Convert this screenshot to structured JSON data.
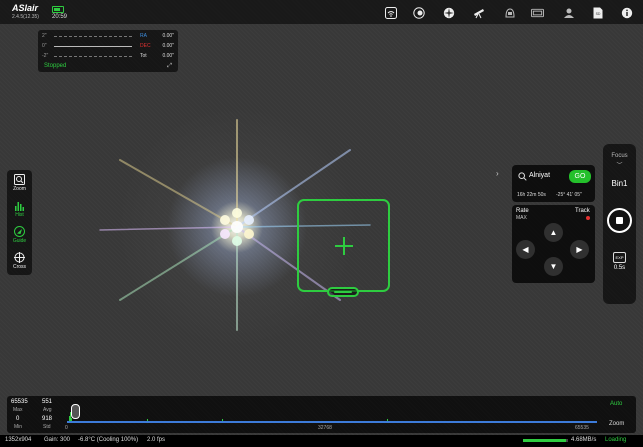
{
  "app": {
    "logo": "ASIair",
    "version": "2.4.5(12.35)",
    "clock": "20:59"
  },
  "topbar_icons": [
    "wifi-icon",
    "camera-icon",
    "guide-scope-icon",
    "telescope-icon",
    "mount-icon",
    "filter-wheel-icon",
    "focuser-icon",
    "storage-icon",
    "info-icon"
  ],
  "guide_graph": {
    "scales": [
      "2\"",
      "0\"",
      "-2\""
    ],
    "ra_label": "RA",
    "ra_value": "0.00\"",
    "dec_label": "DEC",
    "dec_value": "0.00\"",
    "tot_label": "Tot",
    "tot_value": "0.00\"",
    "status": "Stopped",
    "colors": {
      "ra": "#3d8ee0",
      "dec": "#e23131"
    }
  },
  "left_toolbar": [
    {
      "label": "Zoom",
      "icon": "zoom-icon"
    },
    {
      "label": "Hist",
      "icon": "histogram-icon"
    },
    {
      "label": "Guide",
      "icon": "guide-icon"
    },
    {
      "label": "Cross",
      "icon": "crosshair-icon"
    }
  ],
  "target": {
    "name": "Alniyat",
    "go_label": "GO",
    "ra": "16h 22m 50s",
    "dec": "-25° 41' 05\""
  },
  "mount": {
    "rate_label": "Rate",
    "rate_value": "MAX",
    "track_label": "Track",
    "directions": [
      "▲",
      "◀",
      "▶",
      "▼"
    ]
  },
  "capture": {
    "focus_label": "Focus",
    "bin": "Bin1",
    "exp_icon_label": "EXP",
    "exposure": "0.5s"
  },
  "histogram": {
    "max_value": "65535",
    "max_label": "Max",
    "avg_value": "551",
    "avg_label": "Avg",
    "min_value": "0",
    "min_label": "Min",
    "std_value": "918",
    "std_label": "Std",
    "scale_start": "0",
    "scale_mid": "32768",
    "scale_end": "65535",
    "auto_label": "Auto",
    "zoom_label": "Zoom"
  },
  "status": {
    "resolution": "1352x904",
    "gain": "Gain: 300",
    "temperature": "-6.8°C (Cooling 100%)",
    "fps": "2.0 fps",
    "transfer_rate": "4.68MB/s",
    "state": "Loading",
    "progress": 0.95
  },
  "accent_color": "#2ecc40"
}
